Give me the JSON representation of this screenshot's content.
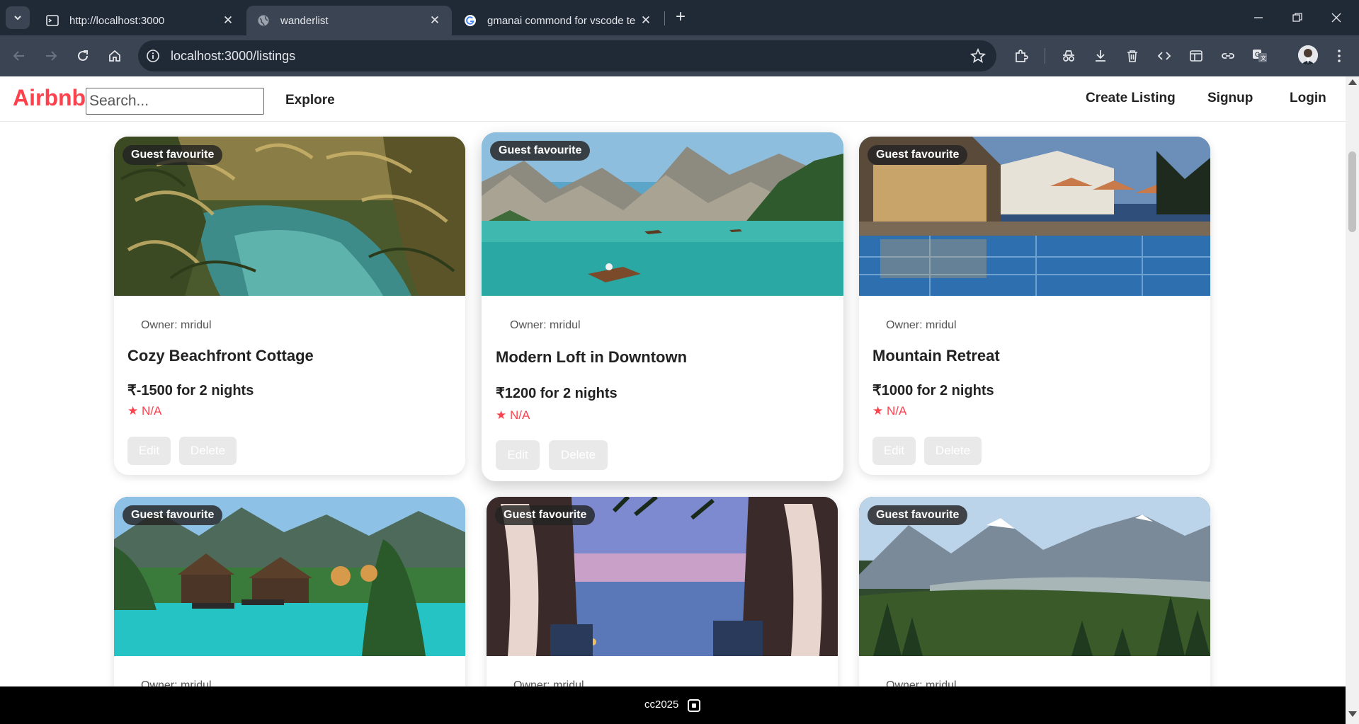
{
  "browser": {
    "tabs": [
      {
        "title": "http://localhost:3000",
        "icon": "terminal-icon",
        "active": false
      },
      {
        "title": "wanderlist",
        "icon": "globe-icon",
        "active": true
      },
      {
        "title": "gmanai commond for vscode te",
        "icon": "google-icon",
        "active": false
      }
    ],
    "address": "localhost:3000/listings"
  },
  "site": {
    "brand": "Airbnb",
    "search_placeholder": "Search...",
    "explore": "Explore",
    "create_listing": "Create Listing",
    "signup": "Signup",
    "login": "Login"
  },
  "listings": [
    {
      "badge": "Guest favourite",
      "owner": "Owner: mridul",
      "title": "Cozy Beachfront Cottage",
      "price": "₹-1500 for 2 nights",
      "rating": "★ N/A",
      "edit": "Edit",
      "delete": "Delete",
      "image": "palm-lagoon-image"
    },
    {
      "badge": "Guest favourite",
      "owner": "Owner: mridul",
      "title": "Modern Loft in Downtown",
      "price": "₹1200 for 2 nights",
      "rating": "★ N/A",
      "edit": "Edit",
      "delete": "Delete",
      "image": "mountain-lake-image"
    },
    {
      "badge": "Guest favourite",
      "owner": "Owner: mridul",
      "title": "Mountain Retreat",
      "price": "₹1000 for 2 nights",
      "rating": "★ N/A",
      "edit": "Edit",
      "delete": "Delete",
      "image": "resort-pool-image"
    },
    {
      "badge": "Guest favourite",
      "owner": "Owner: mridul",
      "image": "tropical-resort-image"
    },
    {
      "badge": "Guest favourite",
      "owner": "Owner: mridul",
      "image": "sunset-cabana-image"
    },
    {
      "badge": "Guest favourite",
      "owner": "Owner: mridul",
      "image": "alpine-valley-image"
    }
  ],
  "footer": {
    "text": "cc2025"
  },
  "colors": {
    "brand": "#fe424d",
    "chrome_dark": "#202a37",
    "chrome_mid": "#3a4452"
  }
}
